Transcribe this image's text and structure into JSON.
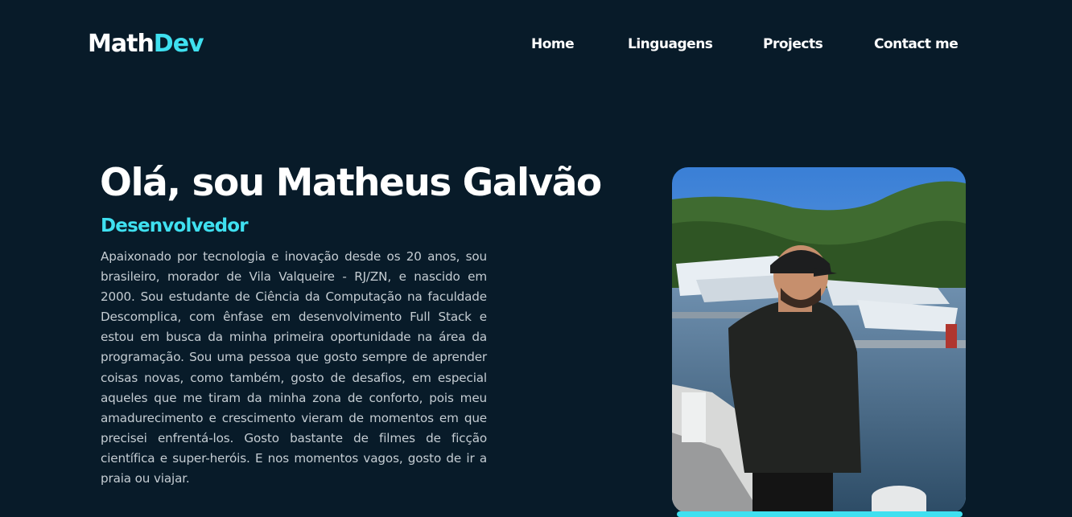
{
  "header": {
    "logo_prefix": "Math",
    "logo_accent": "Dev",
    "nav": [
      {
        "label": "Home"
      },
      {
        "label": "Linguagens"
      },
      {
        "label": "Projects"
      },
      {
        "label": "Contact me"
      }
    ]
  },
  "hero": {
    "title": "Olá, sou Matheus Galvão",
    "role": "Desenvolvedor",
    "bio": "Apaixonado por tecnologia e inovação desde os 20 anos, sou brasileiro, morador de Vila Valqueire - RJ/ZN, e nascido em 2000. Sou estudante de Ciência da Computação na faculdade Descomplica, com ênfase em desenvolvimento Full Stack e estou em busca da minha primeira oportunidade na área da programação. Sou uma pessoa que gosto sempre de aprender coisas novas, como também, gosto de desafios, em especial aqueles que me tiram da minha zona de conforto, pois meu amadurecimento e crescimento vieram de momentos em que precisei enfrentá-los. Gosto bastante de filmes de ficção científica e super-heróis. E nos momentos vagos, gosto de ir a praia ou viajar."
  },
  "colors": {
    "background": "#081b29",
    "accent": "#3fe0f0",
    "text": "#ffffff",
    "body_text": "#c4ccd2"
  }
}
